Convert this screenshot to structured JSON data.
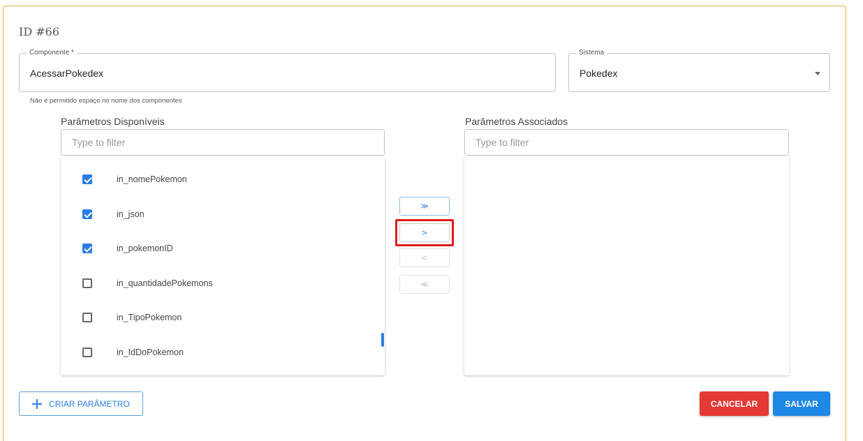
{
  "header": {
    "title": "ID #66"
  },
  "componente": {
    "label": "Componente *",
    "value": "AcessarPokedex",
    "helper": "Não é permitido espaço no nome dos componentes"
  },
  "sistema": {
    "label": "Sistema",
    "value": "Pokedex"
  },
  "available": {
    "title": "Parâmetros Disponíveis",
    "filter_placeholder": "Type to filter",
    "items": [
      {
        "label": "in_nomePokemon",
        "checked": true
      },
      {
        "label": "in_json",
        "checked": true
      },
      {
        "label": "in_pokemonID",
        "checked": true
      },
      {
        "label": "in_quantidadePokemons",
        "checked": false
      },
      {
        "label": "in_TipoPokemon",
        "checked": false
      },
      {
        "label": "in_IdDoPokemon",
        "checked": false
      }
    ]
  },
  "associated": {
    "title": "Parâmetros Associados",
    "filter_placeholder": "Type to filter",
    "items": []
  },
  "transfer": {
    "move_all_right": "≫",
    "move_right": ">",
    "move_left": "<",
    "move_all_left": "≪"
  },
  "actions": {
    "criar_label": "CRIAR PARÂMETRO",
    "cancelar_label": "CANCELAR",
    "salvar_label": "SALVAR"
  },
  "colors": {
    "primary": "#1e88e5",
    "danger": "#e53935",
    "highlight": "#e01b1b",
    "card_border": "#e0b042"
  }
}
